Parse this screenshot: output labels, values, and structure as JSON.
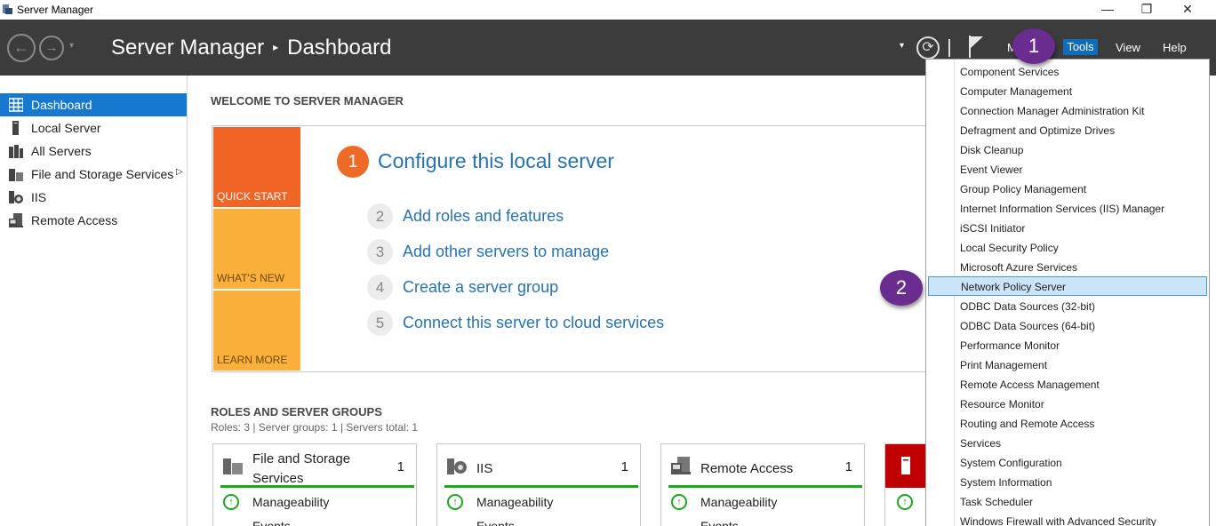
{
  "window": {
    "title": "Server Manager",
    "minimize": "—",
    "restore": "❐",
    "close": "✕"
  },
  "header": {
    "back": "←",
    "forward": "→",
    "history_dropdown": "▾",
    "app": "Server Manager",
    "separator": "▸",
    "page": "Dashboard",
    "refresh_dropdown": "▾",
    "refresh": "⟳",
    "manage_partial": "M",
    "tools": "Tools",
    "view": "View",
    "help": "Help"
  },
  "callouts": [
    "1",
    "2"
  ],
  "sidebar": {
    "items": [
      {
        "label": "Dashboard",
        "icon": "dashboard-icon"
      },
      {
        "label": "Local Server",
        "icon": "server-icon"
      },
      {
        "label": "All Servers",
        "icon": "servers-icon"
      },
      {
        "label": "File and Storage Services",
        "icon": "storage-icon"
      },
      {
        "label": "IIS",
        "icon": "iis-icon"
      },
      {
        "label": "Remote Access",
        "icon": "remote-access-icon"
      }
    ],
    "expand_arrow": "▷"
  },
  "welcome": {
    "title": "WELCOME TO SERVER MANAGER",
    "tiles": [
      "QUICK START",
      "WHAT'S NEW",
      "LEARN MORE"
    ],
    "primary_step": {
      "number": "1",
      "label": "Configure this local server"
    },
    "steps": [
      {
        "number": "2",
        "label": "Add roles and features"
      },
      {
        "number": "3",
        "label": "Add other servers to manage"
      },
      {
        "number": "4",
        "label": "Create a server group"
      },
      {
        "number": "5",
        "label": "Connect this server to cloud services"
      }
    ]
  },
  "roles": {
    "title": "ROLES AND SERVER GROUPS",
    "summary": "Roles: 3   |   Server groups: 1   |   Servers total: 1",
    "cards": [
      {
        "title": "File and Storage Services",
        "count": "1",
        "manageability": "Manageability",
        "events": "Events"
      },
      {
        "title": "IIS",
        "count": "1",
        "manageability": "Manageability",
        "events": "Events"
      },
      {
        "title": "Remote Access",
        "count": "1",
        "manageability": "Manageability",
        "events": "Events"
      }
    ]
  },
  "tools_menu": {
    "items": [
      "Component Services",
      "Computer Management",
      "Connection Manager Administration Kit",
      "Defragment and Optimize Drives",
      "Disk Cleanup",
      "Event Viewer",
      "Group Policy Management",
      "Internet Information Services (IIS) Manager",
      "iSCSI Initiator",
      "Local Security Policy",
      "Microsoft Azure Services",
      "Network Policy Server",
      "ODBC Data Sources (32-bit)",
      "ODBC Data Sources (64-bit)",
      "Performance Monitor",
      "Print Management",
      "Remote Access Management",
      "Resource Monitor",
      "Routing and Remote Access",
      "Services",
      "System Configuration",
      "System Information",
      "Task Scheduler",
      "Windows Firewall with Advanced Security"
    ],
    "highlighted": "Network Policy Server"
  },
  "colors": {
    "header_bg": "#3c3c3c",
    "accent": "#1679cf",
    "quick_start": "#f06526",
    "whats_new": "#fbb03b",
    "callout": "#6a2d8f",
    "status_green": "#1ba81b",
    "alert_red": "#c00000"
  }
}
